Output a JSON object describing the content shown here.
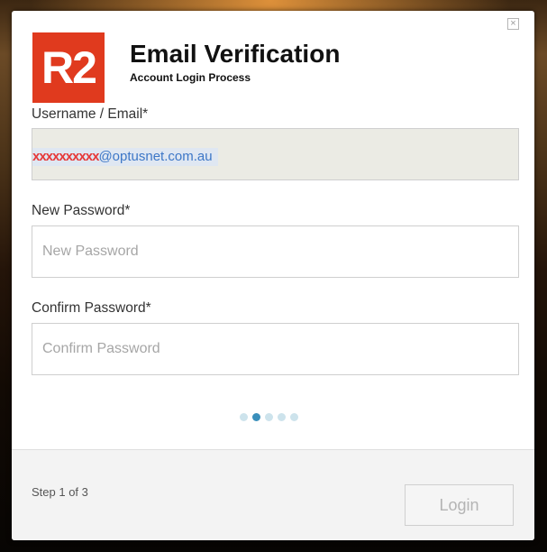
{
  "dialog": {
    "close_label": "×",
    "logo_text": "R2",
    "title": "Email Verification",
    "subtitle": "Account Login Process"
  },
  "form": {
    "username": {
      "label": "Username / Email*",
      "value_redacted": "xxxxxxxxxx",
      "value_domain": "@optusnet.com.au"
    },
    "new_password": {
      "label": "New Password*",
      "placeholder": "New Password",
      "value": ""
    },
    "confirm_password": {
      "label": "Confirm Password*",
      "placeholder": "Confirm Password",
      "value": ""
    }
  },
  "progress": {
    "total_dots": 5,
    "active_index": 1
  },
  "footer": {
    "step_text": "Step 1 of 3",
    "login_label": "Login"
  },
  "colors": {
    "logo_red": "#e03a1e",
    "active_dot": "#3a8fbb",
    "inactive_dot": "#cde3ec",
    "readonly_field": "#ebebe4"
  }
}
